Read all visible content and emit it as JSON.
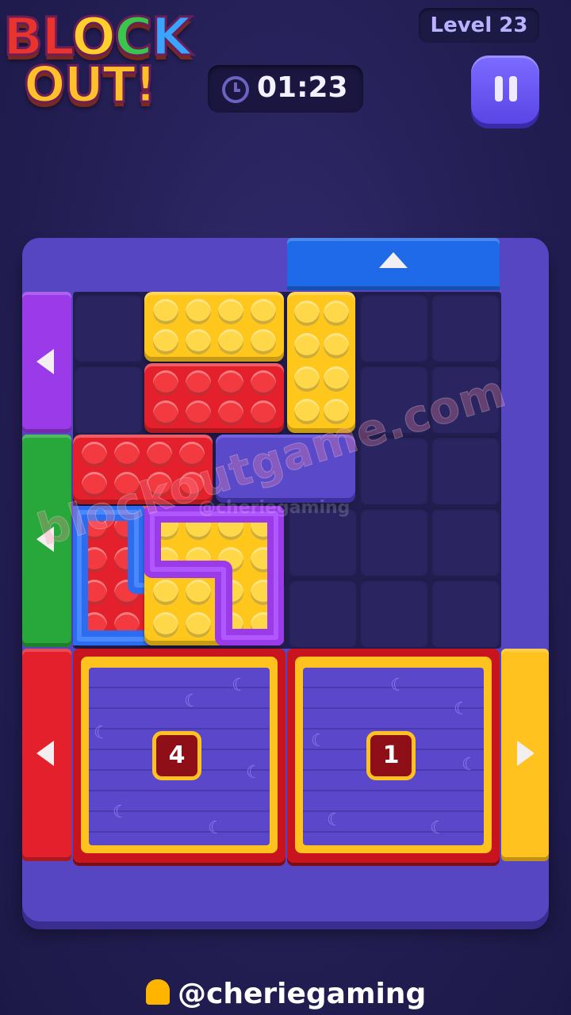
{
  "logo": {
    "line1": [
      "BL",
      "O",
      "C",
      "K"
    ],
    "line2": "OUT!"
  },
  "level": {
    "label": "Level 23"
  },
  "timer": {
    "value": "01:23",
    "icon": "clock-icon"
  },
  "pause": {
    "icon": "pause-icon"
  },
  "colors": {
    "yellow": "#ffc61c",
    "red": "#e3202b",
    "blue": "#2c6cf0",
    "purple": "#9a3ae8",
    "green": "#28a83a",
    "board": "#5646c2"
  },
  "exits": [
    {
      "color": "red",
      "count": "4"
    },
    {
      "color": "red",
      "count": "1"
    }
  ],
  "watermark": {
    "main": "blockoutgame.com",
    "small": "@cheriegaming"
  },
  "credit": {
    "text": "@cheriegaming"
  }
}
